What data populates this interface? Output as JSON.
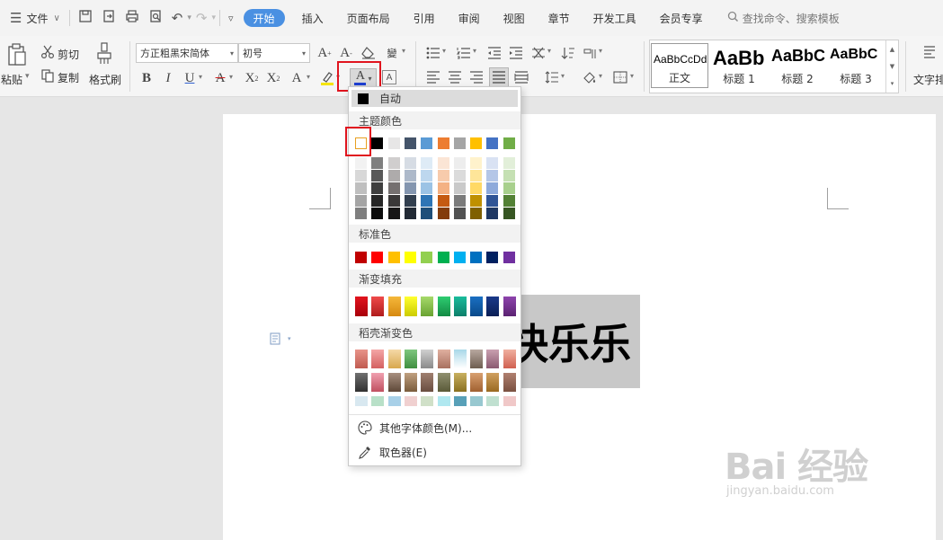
{
  "menubar": {
    "menu_icon": "hamburger-icon",
    "file_label": "文件",
    "tabs": [
      "开始",
      "插入",
      "页面布局",
      "引用",
      "审阅",
      "视图",
      "章节",
      "开发工具",
      "会员专享"
    ],
    "active_tab": "开始",
    "search_placeholder": "查找命令、搜索模板"
  },
  "ribbon": {
    "paste_label": "粘贴",
    "cut_label": "剪切",
    "copy_label": "复制",
    "format_painter_label": "格式刷",
    "font_name": "方正粗黑宋简体",
    "font_size": "初号",
    "styles": [
      {
        "preview": "AaBbCcDd",
        "label": "正文"
      },
      {
        "preview": "AaBb",
        "label": "标题 1"
      },
      {
        "preview": "AaBbC",
        "label": "标题 2"
      },
      {
        "preview": "AaBbC",
        "label": "标题 3"
      }
    ],
    "text_layout_label": "文字排"
  },
  "font_color_menu": {
    "auto_label": "自动",
    "theme_header": "主题颜色",
    "theme_top_row": [
      "#ffffff",
      "#000000",
      "#e7e6e6",
      "#44546a",
      "#5b9bd5",
      "#ed7d31",
      "#a5a5a5",
      "#ffc000",
      "#4472c4",
      "#70ad47"
    ],
    "theme_shades": [
      [
        "#f2f2f2",
        "#7f7f7f",
        "#d0cece",
        "#d6dce4",
        "#deebf6",
        "#fbe5d5",
        "#ededed",
        "#fff2cc",
        "#d9e2f3",
        "#e2efd9"
      ],
      [
        "#d8d8d8",
        "#595959",
        "#aeabab",
        "#adb9ca",
        "#bdd7ee",
        "#f7cbac",
        "#dbdbdb",
        "#fee599",
        "#b4c6e7",
        "#c5e0b3"
      ],
      [
        "#bfbfbf",
        "#3f3f3f",
        "#757070",
        "#8496b0",
        "#9cc3e5",
        "#f4b183",
        "#c9c9c9",
        "#ffd965",
        "#8eaadb",
        "#a8d08d"
      ],
      [
        "#a5a5a5",
        "#262626",
        "#3a3838",
        "#323f4f",
        "#2e75b5",
        "#c55a11",
        "#7b7b7b",
        "#bf9000",
        "#2f5496",
        "#538135"
      ],
      [
        "#7f7f7f",
        "#0c0c0c",
        "#171616",
        "#222a35",
        "#1e4e79",
        "#833c0b",
        "#525252",
        "#7f6000",
        "#1f3864",
        "#375623"
      ]
    ],
    "standard_header": "标准色",
    "standard_colors": [
      "#c00000",
      "#ff0000",
      "#ffc000",
      "#ffff00",
      "#92d050",
      "#00b050",
      "#00b0f0",
      "#0070c0",
      "#002060",
      "#7030a0"
    ],
    "gradient_header": "渐变填充",
    "gradient_colors": [
      [
        "#e2141e",
        "#a8000a"
      ],
      [
        "#ef4a4a",
        "#b01c1c"
      ],
      [
        "#f5b83a",
        "#d68910"
      ],
      [
        "#ffff30",
        "#cccc00"
      ],
      [
        "#a6d96a",
        "#6aa332"
      ],
      [
        "#2ecc71",
        "#138a44"
      ],
      [
        "#1abc9c",
        "#0d7f6a"
      ],
      [
        "#1a6fc2",
        "#0a4a8a"
      ],
      [
        "#1a3a8a",
        "#0a1f55"
      ],
      [
        "#8e44ad",
        "#5b2372"
      ]
    ],
    "docer_header": "稻壳渐变色",
    "docer_rows": [
      [
        [
          "#e8948a",
          "#c05b50"
        ],
        [
          "#f4a6a6",
          "#d46060"
        ],
        [
          "#f5d9a8",
          "#d8a84e"
        ],
        [
          "#7ec77e",
          "#3f8f3f"
        ],
        [
          "#d0d0d0",
          "#8a8a8a"
        ],
        [
          "#e0b0a0",
          "#a8705f"
        ],
        [
          "#a8d8e8",
          "#ffffff"
        ],
        [
          "#b8a8a0",
          "#6e5e50"
        ],
        [
          "#c9a0b0",
          "#8a5a70"
        ],
        [
          "#f0b0a0",
          "#d06050"
        ]
      ],
      [
        [
          "#707070",
          "#303030"
        ],
        [
          "#f0a0b0",
          "#c05060"
        ],
        [
          "#a89080",
          "#5e4838"
        ],
        [
          "#c0a080",
          "#7a5c3c"
        ],
        [
          "#a08070",
          "#6a4e40"
        ],
        [
          "#909070",
          "#5a5a38"
        ],
        [
          "#c8b060",
          "#8a7020"
        ],
        [
          "#d8a070",
          "#a06030"
        ],
        [
          "#d0a060",
          "#9a6a20"
        ],
        [
          "#b08070",
          "#7a5040"
        ]
      ],
      [
        [
          "#d8e8f0",
          "#d8e8f0"
        ],
        [
          "#b8e0c8",
          "#b8e0c8"
        ],
        [
          "#a8d0e8",
          "#a8d0e8"
        ],
        [
          "#f0d0d0",
          "#f0d0d0"
        ],
        [
          "#d0e0c8",
          "#d0e0c8"
        ],
        [
          "#b0e8f0",
          "#b0e8f0"
        ],
        [
          "#58a0b8",
          "#58a0b8"
        ],
        [
          "#98c8d0",
          "#98c8d0"
        ],
        [
          "#c0e0d0",
          "#c0e0d0"
        ],
        [
          "#f0c8c8",
          "#f0c8c8"
        ]
      ]
    ],
    "more_colors_label": "其他字体颜色(M)...",
    "eyedropper_label": "取色器(E)"
  },
  "document": {
    "text": "快乐乐"
  },
  "watermark": {
    "logo": "Bai 经验",
    "url": "jingyan.baidu.com"
  }
}
